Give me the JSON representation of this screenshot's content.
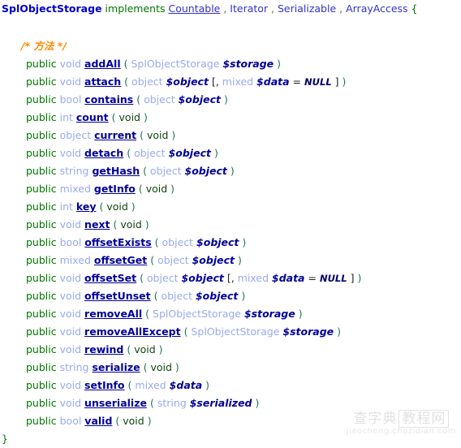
{
  "header": {
    "class_name": "SplObjectStorage",
    "implements_keyword": "implements",
    "interfaces": [
      "Countable",
      "Iterator",
      "Serializable",
      "ArrayAccess"
    ],
    "separator": ",",
    "open_brace": "{"
  },
  "comment": "/* 方法 */",
  "closing_brace": "}",
  "tokens": {
    "modifier": "public",
    "open_paren": "(",
    "close_paren": ")",
    "open_bracket": "[",
    "close_bracket": "]",
    "comma": ",",
    "equals": "=",
    "void_param": "void"
  },
  "methods": [
    {
      "modifier": "public",
      "return_type": "void",
      "name": "addAll",
      "params": [
        {
          "type": "SplObjectStorage",
          "var": "$storage"
        }
      ]
    },
    {
      "modifier": "public",
      "return_type": "void",
      "name": "attach",
      "params": [
        {
          "type": "object",
          "var": "$object"
        }
      ],
      "optional": [
        {
          "type": "mixed",
          "var": "$data",
          "default": "NULL"
        }
      ]
    },
    {
      "modifier": "public",
      "return_type": "bool",
      "name": "contains",
      "params": [
        {
          "type": "object",
          "var": "$object"
        }
      ]
    },
    {
      "modifier": "public",
      "return_type": "int",
      "name": "count",
      "params": []
    },
    {
      "modifier": "public",
      "return_type": "object",
      "name": "current",
      "params": []
    },
    {
      "modifier": "public",
      "return_type": "void",
      "name": "detach",
      "params": [
        {
          "type": "object",
          "var": "$object"
        }
      ]
    },
    {
      "modifier": "public",
      "return_type": "string",
      "name": "getHash",
      "params": [
        {
          "type": "object",
          "var": "$object"
        }
      ]
    },
    {
      "modifier": "public",
      "return_type": "mixed",
      "name": "getInfo",
      "params": []
    },
    {
      "modifier": "public",
      "return_type": "int",
      "name": "key",
      "params": []
    },
    {
      "modifier": "public",
      "return_type": "void",
      "name": "next",
      "params": []
    },
    {
      "modifier": "public",
      "return_type": "bool",
      "name": "offsetExists",
      "params": [
        {
          "type": "object",
          "var": "$object"
        }
      ]
    },
    {
      "modifier": "public",
      "return_type": "mixed",
      "name": "offsetGet",
      "params": [
        {
          "type": "object",
          "var": "$object"
        }
      ]
    },
    {
      "modifier": "public",
      "return_type": "void",
      "name": "offsetSet",
      "params": [
        {
          "type": "object",
          "var": "$object"
        }
      ],
      "optional": [
        {
          "type": "mixed",
          "var": "$data",
          "default": "NULL"
        }
      ]
    },
    {
      "modifier": "public",
      "return_type": "void",
      "name": "offsetUnset",
      "params": [
        {
          "type": "object",
          "var": "$object"
        }
      ]
    },
    {
      "modifier": "public",
      "return_type": "void",
      "name": "removeAll",
      "params": [
        {
          "type": "SplObjectStorage",
          "var": "$storage"
        }
      ]
    },
    {
      "modifier": "public",
      "return_type": "void",
      "name": "removeAllExcept",
      "params": [
        {
          "type": "SplObjectStorage",
          "var": "$storage"
        }
      ]
    },
    {
      "modifier": "public",
      "return_type": "void",
      "name": "rewind",
      "params": []
    },
    {
      "modifier": "public",
      "return_type": "string",
      "name": "serialize",
      "params": []
    },
    {
      "modifier": "public",
      "return_type": "void",
      "name": "setInfo",
      "params": [
        {
          "type": "mixed",
          "var": "$data"
        }
      ]
    },
    {
      "modifier": "public",
      "return_type": "void",
      "name": "unserialize",
      "params": [
        {
          "type": "string",
          "var": "$serialized"
        }
      ]
    },
    {
      "modifier": "public",
      "return_type": "bool",
      "name": "valid",
      "params": []
    }
  ],
  "watermark": {
    "brand": "查字典",
    "box": "教程网",
    "url": "jiaocheng.chazidian.com"
  },
  "colors": {
    "class_name": "#0000cc",
    "keyword": "#007700",
    "interface": "#3333cc",
    "comment": "#ff8800",
    "type": "#99aaee",
    "method_name": "#000099",
    "paren": "#1a7a4c",
    "param": "#000099"
  }
}
